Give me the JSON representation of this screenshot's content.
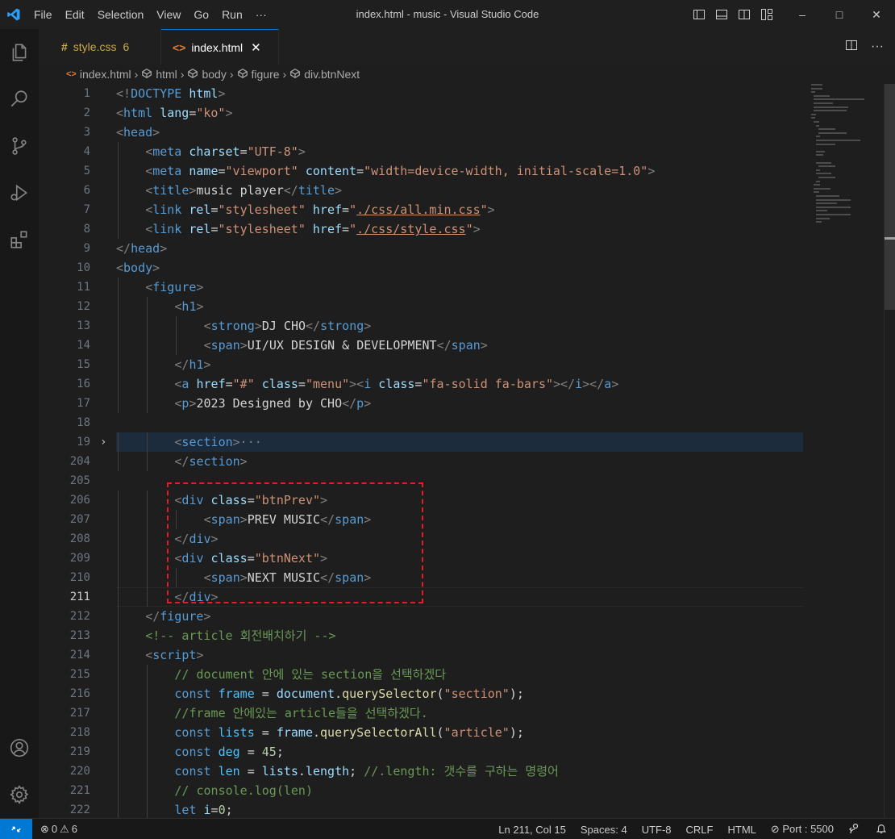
{
  "window": {
    "menu": [
      "File",
      "Edit",
      "Selection",
      "View",
      "Go",
      "Run",
      "···"
    ],
    "title": "index.html - music - Visual Studio Code",
    "minimize": "–",
    "maximize": "□",
    "close": "✕"
  },
  "tabs": [
    {
      "icon": "#",
      "label": "style.css",
      "badge": "6",
      "active": false
    },
    {
      "icon": "<>",
      "label": "index.html",
      "close": "✕",
      "active": true
    }
  ],
  "tab_actions": {
    "more": "···"
  },
  "breadcrumb": [
    "index.html",
    "html",
    "body",
    "figure",
    "div.btnNext"
  ],
  "editor": {
    "current_line": "211",
    "lines": [
      {
        "n": "1",
        "indent": 0,
        "tokens": [
          [
            "br",
            "<!"
          ],
          [
            "tag",
            "DOCTYPE"
          ],
          [
            "txt",
            " "
          ],
          [
            "attr",
            "html"
          ],
          [
            "br",
            ">"
          ]
        ]
      },
      {
        "n": "2",
        "indent": 0,
        "tokens": [
          [
            "br",
            "<"
          ],
          [
            "tag",
            "html"
          ],
          [
            "txt",
            " "
          ],
          [
            "attr",
            "lang"
          ],
          [
            "txt",
            "="
          ],
          [
            "str",
            "\"ko\""
          ],
          [
            "br",
            ">"
          ]
        ]
      },
      {
        "n": "3",
        "indent": 0,
        "tokens": [
          [
            "br",
            "<"
          ],
          [
            "tag",
            "head"
          ],
          [
            "br",
            ">"
          ]
        ]
      },
      {
        "n": "4",
        "indent": 1,
        "tokens": [
          [
            "br",
            "<"
          ],
          [
            "tag",
            "meta"
          ],
          [
            "txt",
            " "
          ],
          [
            "attr",
            "charset"
          ],
          [
            "txt",
            "="
          ],
          [
            "str",
            "\"UTF-8\""
          ],
          [
            "br",
            ">"
          ]
        ]
      },
      {
        "n": "5",
        "indent": 1,
        "tokens": [
          [
            "br",
            "<"
          ],
          [
            "tag",
            "meta"
          ],
          [
            "txt",
            " "
          ],
          [
            "attr",
            "name"
          ],
          [
            "txt",
            "="
          ],
          [
            "str",
            "\"viewport\""
          ],
          [
            "txt",
            " "
          ],
          [
            "attr",
            "content"
          ],
          [
            "txt",
            "="
          ],
          [
            "str",
            "\"width=device-width, initial-scale=1.0\""
          ],
          [
            "br",
            ">"
          ]
        ]
      },
      {
        "n": "6",
        "indent": 1,
        "tokens": [
          [
            "br",
            "<"
          ],
          [
            "tag",
            "title"
          ],
          [
            "br",
            ">"
          ],
          [
            "txt",
            "music player"
          ],
          [
            "br",
            "</"
          ],
          [
            "tag",
            "title"
          ],
          [
            "br",
            ">"
          ]
        ]
      },
      {
        "n": "7",
        "indent": 1,
        "tokens": [
          [
            "br",
            "<"
          ],
          [
            "tag",
            "link"
          ],
          [
            "txt",
            " "
          ],
          [
            "attr",
            "rel"
          ],
          [
            "txt",
            "="
          ],
          [
            "str",
            "\"stylesheet\""
          ],
          [
            "txt",
            " "
          ],
          [
            "attr",
            "href"
          ],
          [
            "txt",
            "="
          ],
          [
            "str",
            "\""
          ],
          [
            "strlink",
            "./css/all.min.css"
          ],
          [
            "str",
            "\""
          ],
          [
            "br",
            ">"
          ]
        ]
      },
      {
        "n": "8",
        "indent": 1,
        "tokens": [
          [
            "br",
            "<"
          ],
          [
            "tag",
            "link"
          ],
          [
            "txt",
            " "
          ],
          [
            "attr",
            "rel"
          ],
          [
            "txt",
            "="
          ],
          [
            "str",
            "\"stylesheet\""
          ],
          [
            "txt",
            " "
          ],
          [
            "attr",
            "href"
          ],
          [
            "txt",
            "="
          ],
          [
            "str",
            "\""
          ],
          [
            "strlink",
            "./css/style.css"
          ],
          [
            "str",
            "\""
          ],
          [
            "br",
            ">"
          ]
        ]
      },
      {
        "n": "9",
        "indent": 0,
        "tokens": [
          [
            "br",
            "</"
          ],
          [
            "tag",
            "head"
          ],
          [
            "br",
            ">"
          ]
        ]
      },
      {
        "n": "10",
        "indent": 0,
        "tokens": [
          [
            "br",
            "<"
          ],
          [
            "tag",
            "body"
          ],
          [
            "br",
            ">"
          ]
        ]
      },
      {
        "n": "11",
        "indent": 1,
        "tokens": [
          [
            "br",
            "<"
          ],
          [
            "tag",
            "figure"
          ],
          [
            "br",
            ">"
          ]
        ]
      },
      {
        "n": "12",
        "indent": 2,
        "tokens": [
          [
            "br",
            "<"
          ],
          [
            "tag",
            "h1"
          ],
          [
            "br",
            ">"
          ]
        ]
      },
      {
        "n": "13",
        "indent": 3,
        "tokens": [
          [
            "br",
            "<"
          ],
          [
            "tag",
            "strong"
          ],
          [
            "br",
            ">"
          ],
          [
            "txt",
            "DJ CHO"
          ],
          [
            "br",
            "</"
          ],
          [
            "tag",
            "strong"
          ],
          [
            "br",
            ">"
          ]
        ]
      },
      {
        "n": "14",
        "indent": 3,
        "tokens": [
          [
            "br",
            "<"
          ],
          [
            "tag",
            "span"
          ],
          [
            "br",
            ">"
          ],
          [
            "txt",
            "UI/UX DESIGN & DEVELOPMENT"
          ],
          [
            "br",
            "</"
          ],
          [
            "tag",
            "span"
          ],
          [
            "br",
            ">"
          ]
        ]
      },
      {
        "n": "15",
        "indent": 2,
        "tokens": [
          [
            "br",
            "</"
          ],
          [
            "tag",
            "h1"
          ],
          [
            "br",
            ">"
          ]
        ]
      },
      {
        "n": "16",
        "indent": 2,
        "tokens": [
          [
            "br",
            "<"
          ],
          [
            "tag",
            "a"
          ],
          [
            "txt",
            " "
          ],
          [
            "attr",
            "href"
          ],
          [
            "txt",
            "="
          ],
          [
            "str",
            "\"#\""
          ],
          [
            "txt",
            " "
          ],
          [
            "attr",
            "class"
          ],
          [
            "txt",
            "="
          ],
          [
            "str",
            "\"menu\""
          ],
          [
            "br",
            ">"
          ],
          [
            "br",
            "<"
          ],
          [
            "tag",
            "i"
          ],
          [
            "txt",
            " "
          ],
          [
            "attr",
            "class"
          ],
          [
            "txt",
            "="
          ],
          [
            "str",
            "\"fa-solid fa-bars\""
          ],
          [
            "br",
            ">"
          ],
          [
            "br",
            "</"
          ],
          [
            "tag",
            "i"
          ],
          [
            "br",
            ">"
          ],
          [
            "br",
            "</"
          ],
          [
            "tag",
            "a"
          ],
          [
            "br",
            ">"
          ]
        ]
      },
      {
        "n": "17",
        "indent": 2,
        "tokens": [
          [
            "br",
            "<"
          ],
          [
            "tag",
            "p"
          ],
          [
            "br",
            ">"
          ],
          [
            "txt",
            "2023 Designed by CHO"
          ],
          [
            "br",
            "</"
          ],
          [
            "tag",
            "p"
          ],
          [
            "br",
            ">"
          ]
        ]
      },
      {
        "n": "18",
        "indent": 0,
        "tokens": []
      },
      {
        "n": "19",
        "indent": 2,
        "fold": "›",
        "highlight": true,
        "tokens": [
          [
            "br",
            "<"
          ],
          [
            "tag",
            "section"
          ],
          [
            "br",
            ">"
          ],
          [
            "ell",
            "···"
          ]
        ]
      },
      {
        "n": "204",
        "indent": 2,
        "tokens": [
          [
            "br",
            "</"
          ],
          [
            "tag",
            "section"
          ],
          [
            "br",
            ">"
          ]
        ]
      },
      {
        "n": "205",
        "indent": 0,
        "tokens": []
      },
      {
        "n": "206",
        "indent": 2,
        "tokens": [
          [
            "br",
            "<"
          ],
          [
            "tag",
            "div"
          ],
          [
            "txt",
            " "
          ],
          [
            "attr",
            "class"
          ],
          [
            "txt",
            "="
          ],
          [
            "str",
            "\"btnPrev\""
          ],
          [
            "br",
            ">"
          ]
        ]
      },
      {
        "n": "207",
        "indent": 3,
        "tokens": [
          [
            "br",
            "<"
          ],
          [
            "tag",
            "span"
          ],
          [
            "br",
            ">"
          ],
          [
            "txt",
            "PREV MUSIC"
          ],
          [
            "br",
            "</"
          ],
          [
            "tag",
            "span"
          ],
          [
            "br",
            ">"
          ]
        ]
      },
      {
        "n": "208",
        "indent": 2,
        "tokens": [
          [
            "br",
            "</"
          ],
          [
            "tag",
            "div"
          ],
          [
            "br",
            ">"
          ]
        ]
      },
      {
        "n": "209",
        "indent": 2,
        "tokens": [
          [
            "br",
            "<"
          ],
          [
            "tag",
            "div"
          ],
          [
            "txt",
            " "
          ],
          [
            "attr",
            "class"
          ],
          [
            "txt",
            "="
          ],
          [
            "str",
            "\"btnNext\""
          ],
          [
            "br",
            ">"
          ]
        ]
      },
      {
        "n": "210",
        "indent": 3,
        "tokens": [
          [
            "br",
            "<"
          ],
          [
            "tag",
            "span"
          ],
          [
            "br",
            ">"
          ],
          [
            "txt",
            "NEXT MUSIC"
          ],
          [
            "br",
            "</"
          ],
          [
            "tag",
            "span"
          ],
          [
            "br",
            ">"
          ]
        ]
      },
      {
        "n": "211",
        "indent": 2,
        "current": true,
        "tokens": [
          [
            "br",
            "</"
          ],
          [
            "tag",
            "div"
          ],
          [
            "br",
            ">"
          ]
        ]
      },
      {
        "n": "212",
        "indent": 1,
        "tokens": [
          [
            "br",
            "</"
          ],
          [
            "tag",
            "figure"
          ],
          [
            "br",
            ">"
          ]
        ]
      },
      {
        "n": "213",
        "indent": 1,
        "tokens": [
          [
            "cmt",
            "<!-- article 회전배치하기 -->"
          ]
        ]
      },
      {
        "n": "214",
        "indent": 1,
        "tokens": [
          [
            "br",
            "<"
          ],
          [
            "tag",
            "script"
          ],
          [
            "br",
            ">"
          ]
        ]
      },
      {
        "n": "215",
        "indent": 2,
        "tokens": [
          [
            "cmt",
            "// document 안에 있는 section을 선택하겠다"
          ]
        ]
      },
      {
        "n": "216",
        "indent": 2,
        "tokens": [
          [
            "kw",
            "const"
          ],
          [
            "txt",
            " "
          ],
          [
            "var",
            "frame"
          ],
          [
            "txt",
            " = "
          ],
          [
            "attr",
            "document"
          ],
          [
            "txt",
            "."
          ],
          [
            "fn",
            "querySelector"
          ],
          [
            "txt",
            "("
          ],
          [
            "str",
            "\"section\""
          ],
          [
            "txt",
            ");"
          ]
        ]
      },
      {
        "n": "217",
        "indent": 2,
        "tokens": [
          [
            "cmt",
            "//frame 안에있는 article들을 선택하겠다."
          ]
        ]
      },
      {
        "n": "218",
        "indent": 2,
        "tokens": [
          [
            "kw",
            "const"
          ],
          [
            "txt",
            " "
          ],
          [
            "var",
            "lists"
          ],
          [
            "txt",
            " = "
          ],
          [
            "attr",
            "frame"
          ],
          [
            "txt",
            "."
          ],
          [
            "fn",
            "querySelectorAll"
          ],
          [
            "txt",
            "("
          ],
          [
            "str",
            "\"article\""
          ],
          [
            "txt",
            ");"
          ]
        ]
      },
      {
        "n": "219",
        "indent": 2,
        "tokens": [
          [
            "kw",
            "const"
          ],
          [
            "txt",
            " "
          ],
          [
            "var",
            "deg"
          ],
          [
            "txt",
            " = "
          ],
          [
            "num",
            "45"
          ],
          [
            "txt",
            ";"
          ]
        ]
      },
      {
        "n": "220",
        "indent": 2,
        "tokens": [
          [
            "kw",
            "const"
          ],
          [
            "txt",
            " "
          ],
          [
            "var",
            "len"
          ],
          [
            "txt",
            " = "
          ],
          [
            "attr",
            "lists"
          ],
          [
            "txt",
            "."
          ],
          [
            "attr",
            "length"
          ],
          [
            "txt",
            "; "
          ],
          [
            "cmt",
            "//.length: 갯수를 구하는 명령어"
          ]
        ]
      },
      {
        "n": "221",
        "indent": 2,
        "tokens": [
          [
            "cmt",
            "// console.log(len)"
          ]
        ]
      },
      {
        "n": "222",
        "indent": 2,
        "tokens": [
          [
            "kw",
            "let"
          ],
          [
            "txt",
            " "
          ],
          [
            "attr",
            "i"
          ],
          [
            "txt",
            "="
          ],
          [
            "num",
            "0"
          ],
          [
            "txt",
            ";"
          ]
        ]
      }
    ]
  },
  "status": {
    "errors": "0",
    "warnings": "6",
    "position": "Ln 211, Col 15",
    "spaces": "Spaces: 4",
    "encoding": "UTF-8",
    "eol": "CRLF",
    "language": "HTML",
    "port": "Port : 5500"
  },
  "colors": {
    "accent": "#0078d4",
    "tag": "#569cd6",
    "attribute": "#9cdcfe",
    "string": "#ce9178",
    "comment": "#6a9955",
    "annotation_box": "#e51c23"
  }
}
